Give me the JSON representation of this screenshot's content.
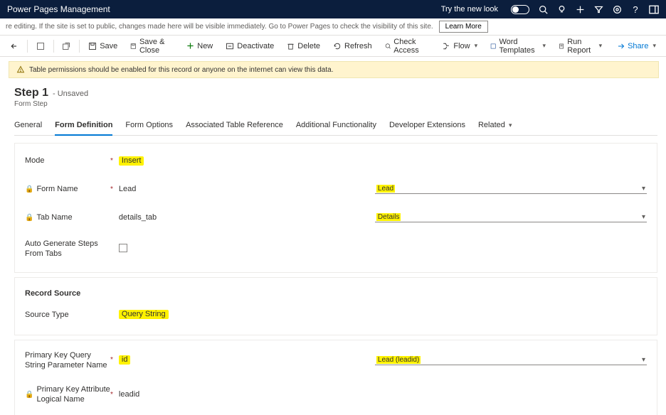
{
  "header": {
    "app_name": "Power Pages Management",
    "try_label": "Try the new look"
  },
  "info_strip": {
    "text": "re editing. If the site is set to public, changes made here will be visible immediately. Go to Power Pages to check the visibility of this site.",
    "learn_more": "Learn More"
  },
  "cmd": {
    "save": "Save",
    "save_close": "Save & Close",
    "new": "New",
    "deactivate": "Deactivate",
    "delete": "Delete",
    "refresh": "Refresh",
    "check_access": "Check Access",
    "flow": "Flow",
    "word": "Word Templates",
    "run_report": "Run Report",
    "share": "Share"
  },
  "warn": "Table permissions should be enabled for this record or anyone on the internet can view this data.",
  "title": {
    "main": "Step 1",
    "state": "- Unsaved",
    "entity": "Form Step"
  },
  "tabs": {
    "general": "General",
    "form_def": "Form Definition",
    "form_opt": "Form Options",
    "assoc": "Associated Table Reference",
    "addl": "Additional Functionality",
    "dev": "Developer Extensions",
    "related": "Related"
  },
  "fields": {
    "mode_label": "Mode",
    "mode_value": "Insert",
    "form_name_label": "Form Name",
    "form_name_value": "Lead",
    "form_name_sel": "Lead",
    "tab_name_label": "Tab Name",
    "tab_name_value": "details_tab",
    "tab_name_sel": "Details",
    "autogen_label": "Auto Generate Steps From Tabs",
    "record_source_hdr": "Record Source",
    "source_type_label": "Source Type",
    "source_type_value": "Query String",
    "pk_qs_label": "Primary Key Query String Parameter Name",
    "pk_qs_value": "id",
    "pk_attr_label": "Primary Key Attribute Logical Name",
    "pk_attr_value": "leadid",
    "pk_attr_sel": "Lead (leadid)"
  }
}
